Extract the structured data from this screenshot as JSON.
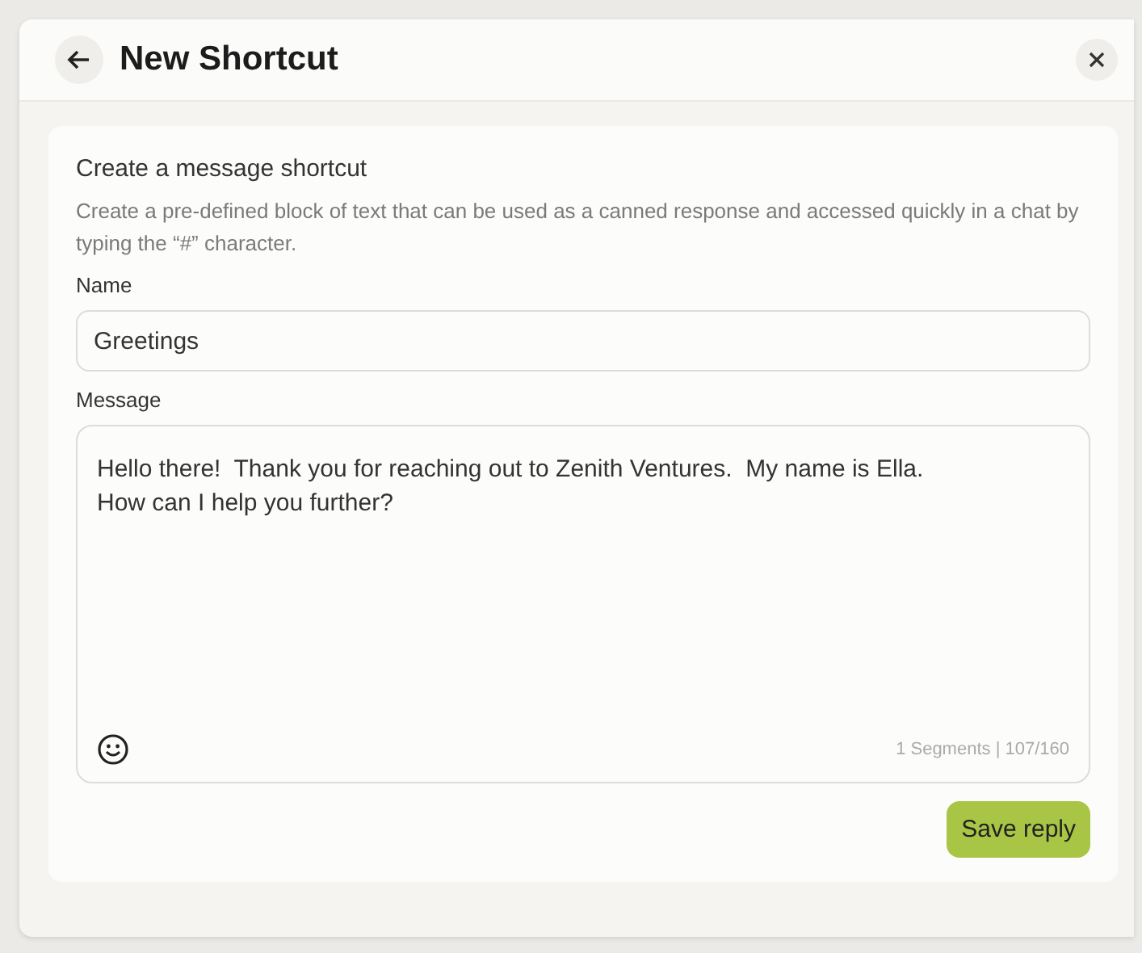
{
  "dialog": {
    "title": "New Shortcut"
  },
  "section": {
    "heading": "Create a message shortcut",
    "description": "Create a pre-defined block of text that can be used as a canned response and accessed quickly in a chat by typing the “#” character."
  },
  "name_field": {
    "label": "Name",
    "value": "Greetings"
  },
  "message_field": {
    "label": "Message",
    "value": "Hello there!  Thank you for reaching out to Zenith Ventures.  My name is Ella.\nHow can I help you further?",
    "counter": "1 Segments | 107/160"
  },
  "buttons": [
    "Save reply"
  ]
}
